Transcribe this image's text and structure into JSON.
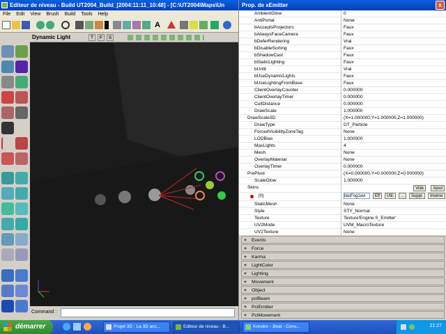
{
  "main_window": {
    "title": "Editeur de niveau - Build UT2004_Build_[2004:11:11_10:48] - [C:\\UT2004\\Maps\\Un"
  },
  "menu": [
    "File",
    "Edit",
    "View",
    "Brush",
    "Build",
    "Tools",
    "Help"
  ],
  "viewport": {
    "title": "Dynamic Light",
    "modes": [
      "T",
      "F",
      "S"
    ]
  },
  "command": {
    "label": "Command :",
    "value": ""
  },
  "props_window": {
    "title": "Prop. de xEmitter",
    "close_label": "x"
  },
  "properties": [
    {
      "k": "AmbientGlow",
      "v": "0"
    },
    {
      "k": "AntiPortal",
      "v": "None"
    },
    {
      "k": "bAcceptsProjectors",
      "v": "Faux"
    },
    {
      "k": "bAlwaysFaceCamera",
      "v": "Faux"
    },
    {
      "k": "bDeferRendering",
      "v": "Vrai"
    },
    {
      "k": "bDisableSorting",
      "v": "Faux"
    },
    {
      "k": "bShadowCast",
      "v": "Faux"
    },
    {
      "k": "bStaticLighting",
      "v": "Faux"
    },
    {
      "k": "bUnlit",
      "v": "Vrai"
    },
    {
      "k": "bUseDynamicLights",
      "v": "Faux"
    },
    {
      "k": "bUseLightingFromBase",
      "v": "Faux"
    },
    {
      "k": "ClientOverlayCounter",
      "v": "0.000000"
    },
    {
      "k": "ClientOverlayTimer",
      "v": "0.000000"
    },
    {
      "k": "CullDistance",
      "v": "0.000000"
    },
    {
      "k": "DrawScale",
      "v": "1.000000"
    },
    {
      "k": "DrawScale3D",
      "v": "(X=1.000000,Y=1.000000,Z=1.000000)"
    },
    {
      "k": "DrawType",
      "v": "DT_Particle"
    },
    {
      "k": "ForcedVisibilityZoneTag",
      "v": "None"
    },
    {
      "k": "LODBias",
      "v": "1.000000"
    },
    {
      "k": "MaxLights",
      "v": "4"
    },
    {
      "k": "Mesh",
      "v": "None"
    },
    {
      "k": "OverlayMaterial",
      "v": "None"
    },
    {
      "k": "OverlayTimer",
      "v": "0.000000"
    },
    {
      "k": "PrePivot",
      "v": "(X=0.000000,Y=0.000000,Z=0.000000)"
    },
    {
      "k": "ScaleGlow",
      "v": "1.000000"
    }
  ],
  "skins": {
    "label": "Skins",
    "add_label": "Ajout",
    "empty_label": "Vide",
    "item_key": "[0]",
    "item_value": "ilasFog1avi",
    "buttons": [
      "Eff",
      "Util.",
      "...",
      "Suppr.",
      "Insérer"
    ]
  },
  "properties_after": [
    {
      "k": "StaticMesh",
      "v": "None"
    },
    {
      "k": "Style",
      "v": "STY_Normal"
    },
    {
      "k": "Texture",
      "v": "Texture'Engine.S_Emitter'"
    },
    {
      "k": "UV2Mode",
      "v": "UVM_MacroTexture"
    },
    {
      "k": "UV2Texture",
      "v": "None"
    }
  ],
  "categories": [
    "Events",
    "Force",
    "Karma",
    "LightColor",
    "Lighting",
    "Movement",
    "Object",
    "pclBeam",
    "PclEmitter",
    "PclMovement"
  ],
  "taskbar": {
    "start_label": "démarrer",
    "tasks": [
      "Projet 3D : La 3D acc...",
      "Editeur de niveau - B...",
      "Konoko - 3ival - Conv..."
    ],
    "clock": "21:27"
  },
  "colors": {
    "titlebar": "#0a5fe0",
    "viewport_bg": "#1b1b1b",
    "taskbar": "#3168d5"
  }
}
